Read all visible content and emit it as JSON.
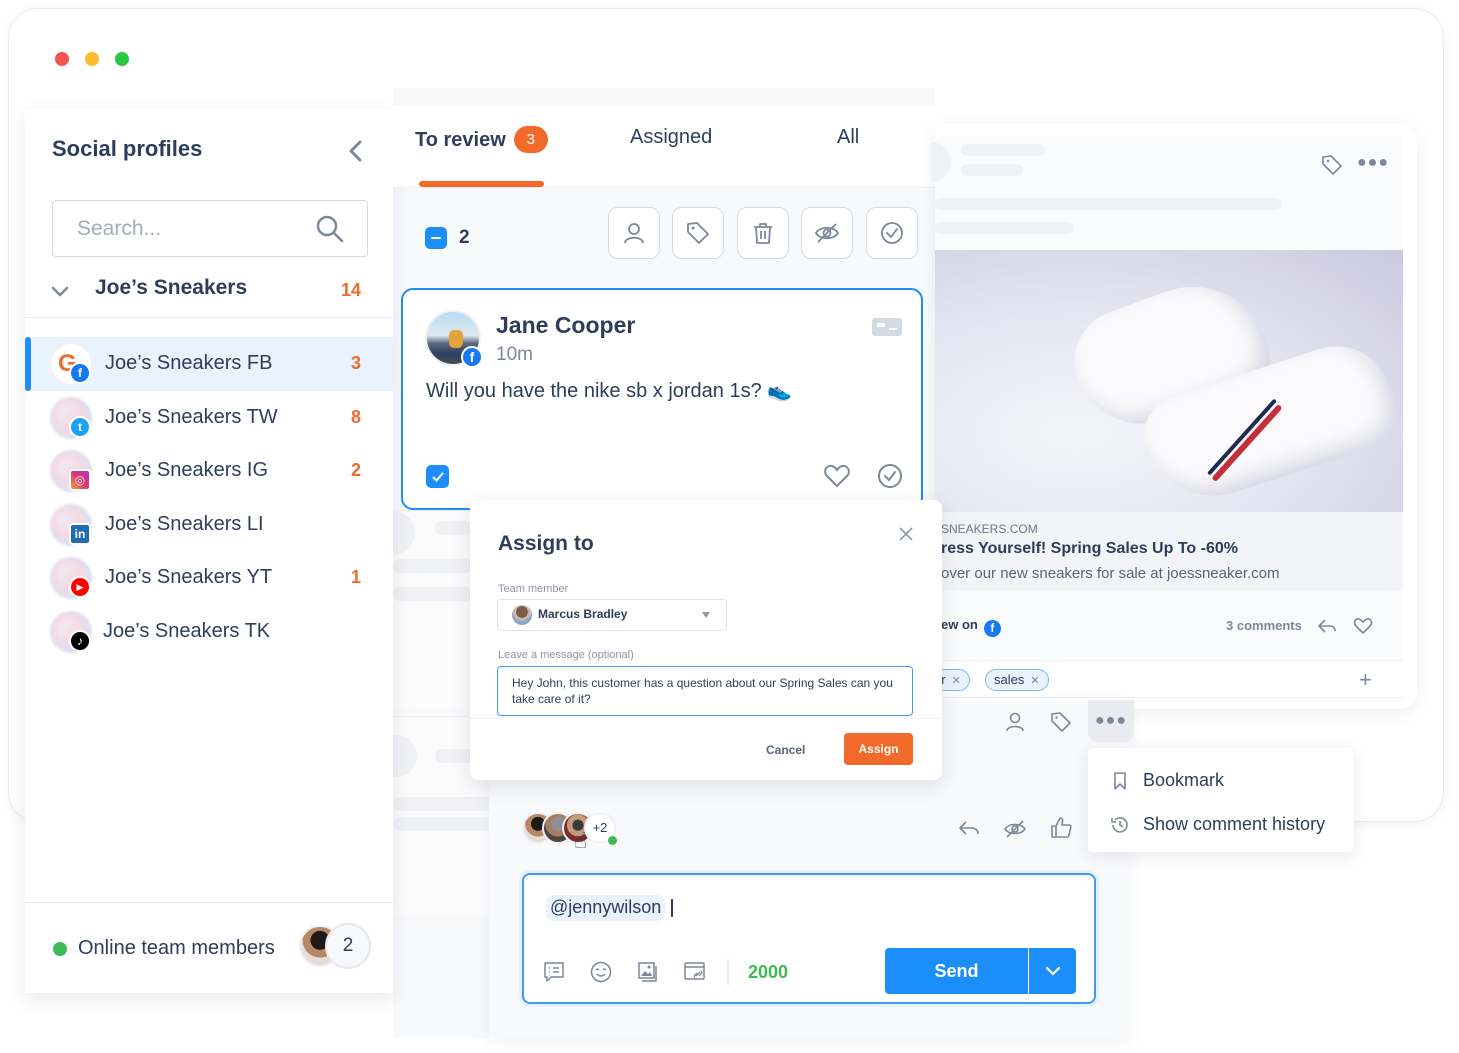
{
  "window": {
    "traffic_lights": [
      {
        "name": "close",
        "color": "#f25451"
      },
      {
        "name": "minimize",
        "color": "#fbbd2e"
      },
      {
        "name": "maximize",
        "color": "#29c841"
      }
    ]
  },
  "sidebar": {
    "title": "Social profiles",
    "collapse_icon": "chevron-left-icon",
    "search": {
      "placeholder": "Search...",
      "value": ""
    },
    "group": {
      "name": "Joe’s Sneakers",
      "count": "14",
      "expanded": true
    },
    "profiles": [
      {
        "label": "Joe’s Sneakers FB",
        "network": "facebook",
        "count": "3",
        "active": true
      },
      {
        "label": "Joe’s Sneakers TW",
        "network": "twitter",
        "count": "8",
        "active": false
      },
      {
        "label": "Joe’s Sneakers IG",
        "network": "instagram",
        "count": "2",
        "active": false
      },
      {
        "label": "Joe’s Sneakers LI",
        "network": "linkedin",
        "count": "",
        "active": false
      },
      {
        "label": "Joe’s Sneakers YT",
        "network": "youtube",
        "count": "1",
        "active": false
      },
      {
        "label": "Joe’s Sneakers TK",
        "network": "tiktok",
        "count": "",
        "active": false
      }
    ],
    "footer": {
      "label": "Online team members",
      "count": "2"
    }
  },
  "inbox": {
    "tabs": [
      {
        "label": "To review",
        "badge": "3",
        "active": true
      },
      {
        "label": "Assigned",
        "active": false
      },
      {
        "label": "All",
        "active": false
      }
    ],
    "bulk": {
      "selected_count": "2"
    },
    "toolbar": [
      "assign-user-icon",
      "tag-icon",
      "trash-icon",
      "hide-icon",
      "check-circle-icon"
    ],
    "message": {
      "author": "Jane Cooper",
      "time": "10m",
      "text": "Will you have the nike sb x jordan 1s? 👟",
      "network": "facebook",
      "checked": true
    }
  },
  "assign_modal": {
    "title": "Assign to",
    "team_member_label": "Team member",
    "team_member_value": "Marcus Bradley",
    "message_label": "Leave a message (optional)",
    "message_value": "Hey John, this customer has a question about our Spring Sales can you take care of it?",
    "cancel_label": "Cancel",
    "assign_label": "Assign"
  },
  "post": {
    "link_domain": "SNEAKERS.COM",
    "link_title": "ress Yourself! Spring Sales Up To -60%",
    "link_desc": "over our new sneakers for sale at joessneaker.com",
    "view_on_label": "ew on",
    "comments_label": "3 comments",
    "tags": [
      {
        "label": "er"
      },
      {
        "label": "sales"
      }
    ]
  },
  "comment_actions": {
    "menu": [
      {
        "label": "Bookmark",
        "icon": "bookmark-icon"
      },
      {
        "label": "Show comment history",
        "icon": "history-icon"
      }
    ],
    "viewers_more": "+2"
  },
  "composer": {
    "mention": "@jennywilson",
    "char_count": "2000",
    "send_label": "Send"
  },
  "colors": {
    "accent_orange": "#f26a2a",
    "accent_blue": "#1c8ef9",
    "online_green": "#3dba54",
    "text_dark": "#2f3d5c"
  }
}
